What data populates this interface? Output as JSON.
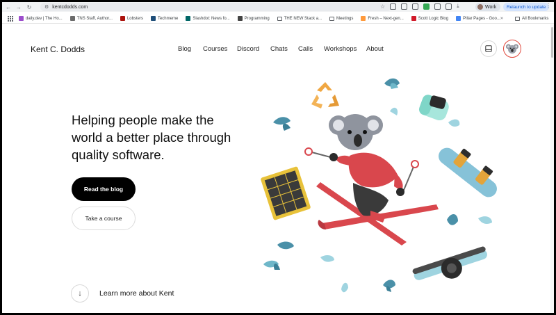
{
  "browser": {
    "url": "kentcdodds.com",
    "profile_label": "Work",
    "relaunch_label": "Relaunch to update"
  },
  "bookmarks": [
    {
      "label": "daily.dev | The Ho...",
      "color": "#9c4dcc"
    },
    {
      "label": "TNS Staff, Author...",
      "color": "#6b6b6b"
    },
    {
      "label": "Lobsters",
      "color": "#ac130d"
    },
    {
      "label": "Techmeme",
      "color": "#1f4e79"
    },
    {
      "label": "Slashdot: News fo...",
      "color": "#006666"
    },
    {
      "label": "Programming",
      "color": "#444444"
    },
    {
      "label": "THE NEW Stack a...",
      "color": "folder"
    },
    {
      "label": "Meetings",
      "color": "folder"
    },
    {
      "label": "Fresh – Next-gen...",
      "color": "#ff9a3c"
    },
    {
      "label": "Scott Logic Blog",
      "color": "#d11a2a"
    },
    {
      "label": "Pillar Pages - Goo...",
      "color": "#4285f4"
    }
  ],
  "bookmarks_more": "»",
  "all_bookmarks_label": "All Bookmarks",
  "site": {
    "name": "Kent C. Dodds",
    "nav": [
      "Blog",
      "Courses",
      "Discord",
      "Chats",
      "Calls",
      "Workshops",
      "About"
    ],
    "headline": "Helping people make the world a better place through quality software.",
    "primary_cta": "Read the blog",
    "secondary_cta": "Take a course",
    "learn_more": "Learn more about Kent"
  },
  "colors": {
    "accent_red": "#e0473c",
    "illustration_teal": "#6fb7c9",
    "ski_red": "#d9474d"
  }
}
